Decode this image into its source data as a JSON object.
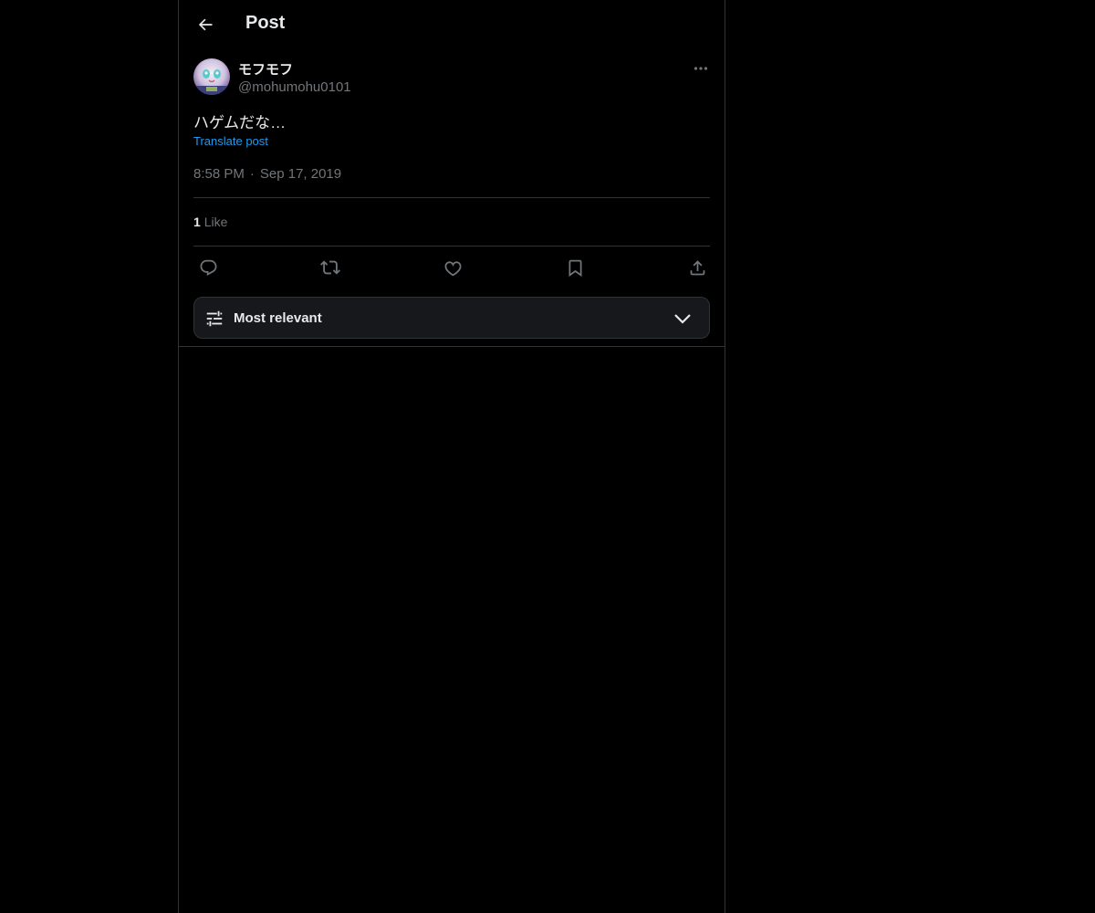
{
  "header": {
    "title": "Post"
  },
  "post": {
    "display_name": "モフモフ",
    "handle": "@mohumohu0101",
    "text": "ハゲムだな…",
    "translate_label": "Translate post",
    "time": "8:58 PM",
    "separator": "·",
    "date": "Sep 17, 2019",
    "like_count": "1",
    "like_label": "Like"
  },
  "actions": [
    "reply-icon",
    "retweet-icon",
    "heart-icon",
    "bookmark-icon",
    "share-icon"
  ],
  "sort": {
    "label": "Most relevant"
  },
  "colors": {
    "background": "#000000",
    "border": "#2f3336",
    "text": "#e7e9ea",
    "muted": "#71767b",
    "link": "#1d9bf0"
  }
}
